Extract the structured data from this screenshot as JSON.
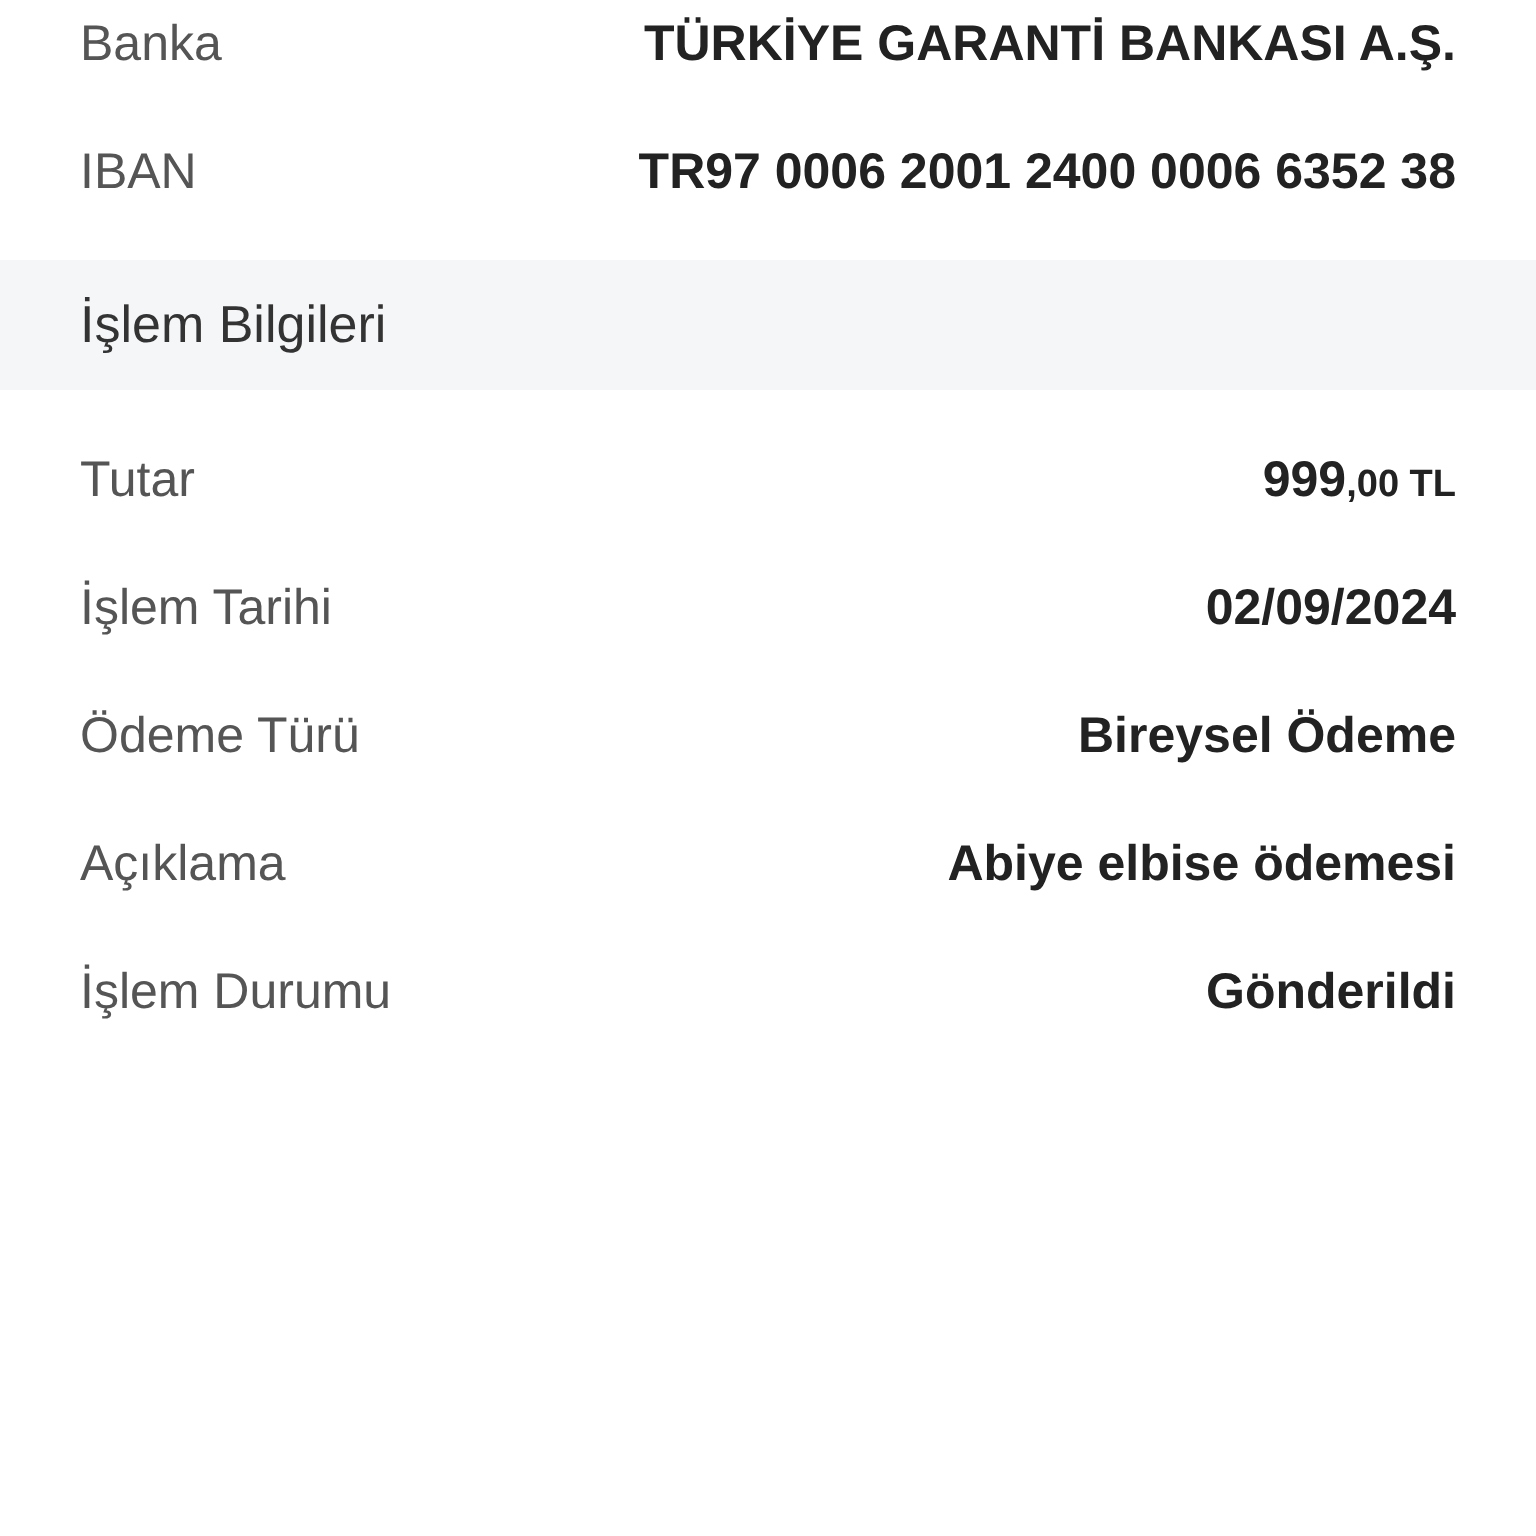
{
  "account_rows": [
    {
      "label": "Banka",
      "kind": "text",
      "value": "TÜRKİYE GARANTİ BANKASI A.Ş."
    },
    {
      "label": "IBAN",
      "kind": "text",
      "value": "TR97 0006 2001 2400 0006 6352 38"
    }
  ],
  "section": {
    "title": "İşlem Bilgileri",
    "rows": [
      {
        "label": "Tutar",
        "kind": "amount",
        "value": "999",
        "minor": ",00 TL"
      },
      {
        "label": "İşlem Tarihi",
        "kind": "text",
        "value": "02/09/2024"
      },
      {
        "label": "Ödeme Türü",
        "kind": "text",
        "value": "Bireysel Ödeme"
      },
      {
        "label": "Açıklama",
        "kind": "text",
        "value": "Abiye elbise ödemesi"
      },
      {
        "label": "İşlem Durumu",
        "kind": "text",
        "value": "Gönderildi"
      }
    ]
  }
}
